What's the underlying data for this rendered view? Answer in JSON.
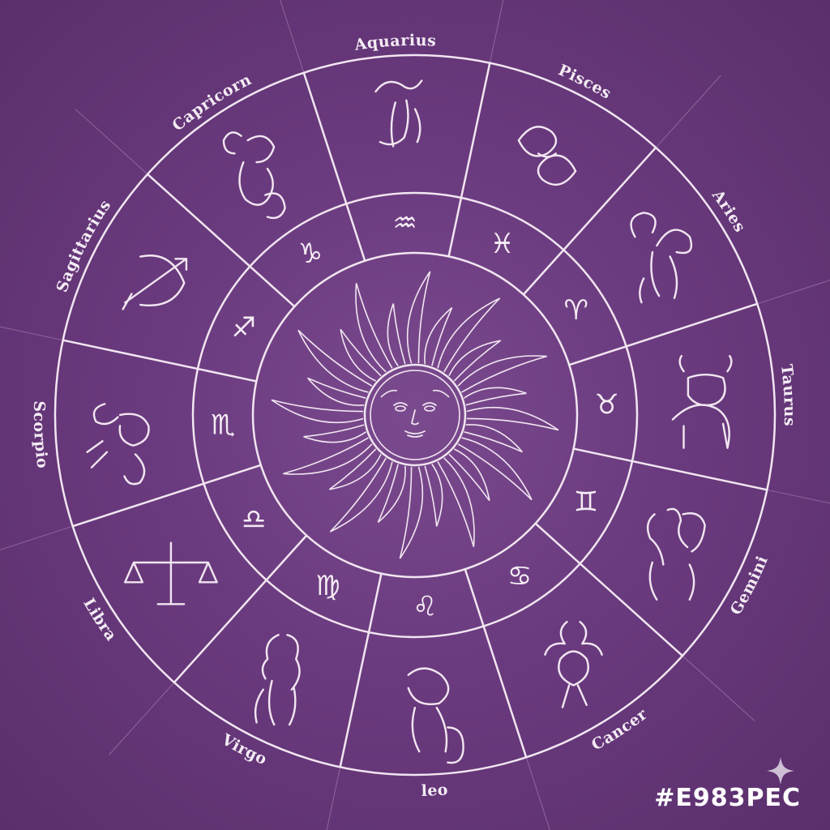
{
  "wheel": {
    "signs": [
      {
        "name": "Aquarius",
        "glyph": "♒"
      },
      {
        "name": "Pisces",
        "glyph": "♓"
      },
      {
        "name": "Aries",
        "glyph": "♈"
      },
      {
        "name": "Taurus",
        "glyph": "♉"
      },
      {
        "name": "Gemini",
        "glyph": "♊"
      },
      {
        "name": "Cancer",
        "glyph": "♋"
      },
      {
        "name": "leo",
        "glyph": "♌"
      },
      {
        "name": "Virgo",
        "glyph": "♍"
      },
      {
        "name": "Libra",
        "glyph": "♎"
      },
      {
        "name": "Scorpio",
        "glyph": "♏"
      },
      {
        "name": "Sagittarius",
        "glyph": "♐"
      },
      {
        "name": "Capricorn",
        "glyph": "♑"
      }
    ],
    "center_icon": "sun-face-icon"
  },
  "watermark": "#E983PEC",
  "colors": {
    "background": "#6a3a7e",
    "line": "#f1e6f1"
  }
}
